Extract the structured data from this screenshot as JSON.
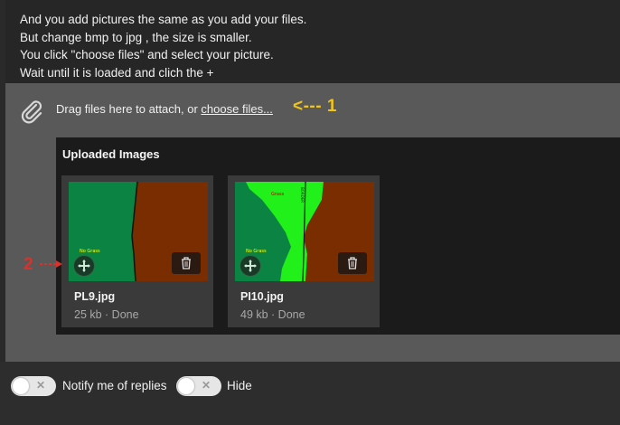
{
  "editor": {
    "lines": [
      "And you add pictures the same as you add your files.",
      "But change bmp to jpg , the size is smaller.",
      "You click \"choose files\" and select your picture.",
      "Wait until it is loaded and clich the +"
    ]
  },
  "attach": {
    "icon": "paperclip-icon",
    "drag_text": "Drag files here to attach, or ",
    "choose_link": "choose files...",
    "annotation_1": "<--- 1"
  },
  "uploaded": {
    "heading": "Uploaded Images",
    "images": [
      {
        "name": "PL9.jpg",
        "meta": "25 kb · Done",
        "thumb_label": "No Grass",
        "colors": {
          "left": "#0b8443",
          "right": "#7a2d00"
        }
      },
      {
        "name": "PI10.jpg",
        "meta": "49 kb · Done",
        "thumb_label": "No Grass",
        "thumb_label_top": "Grass",
        "thumb_label_vertical": "BORDER",
        "colors": {
          "left": "#0b8443",
          "bright": "#22f01a",
          "right": "#7a2d00"
        }
      }
    ],
    "annotation_2": "2"
  },
  "footer": {
    "notify_label": "Notify me of replies",
    "hide_label": "Hide",
    "toggle_icon": "x-icon"
  }
}
